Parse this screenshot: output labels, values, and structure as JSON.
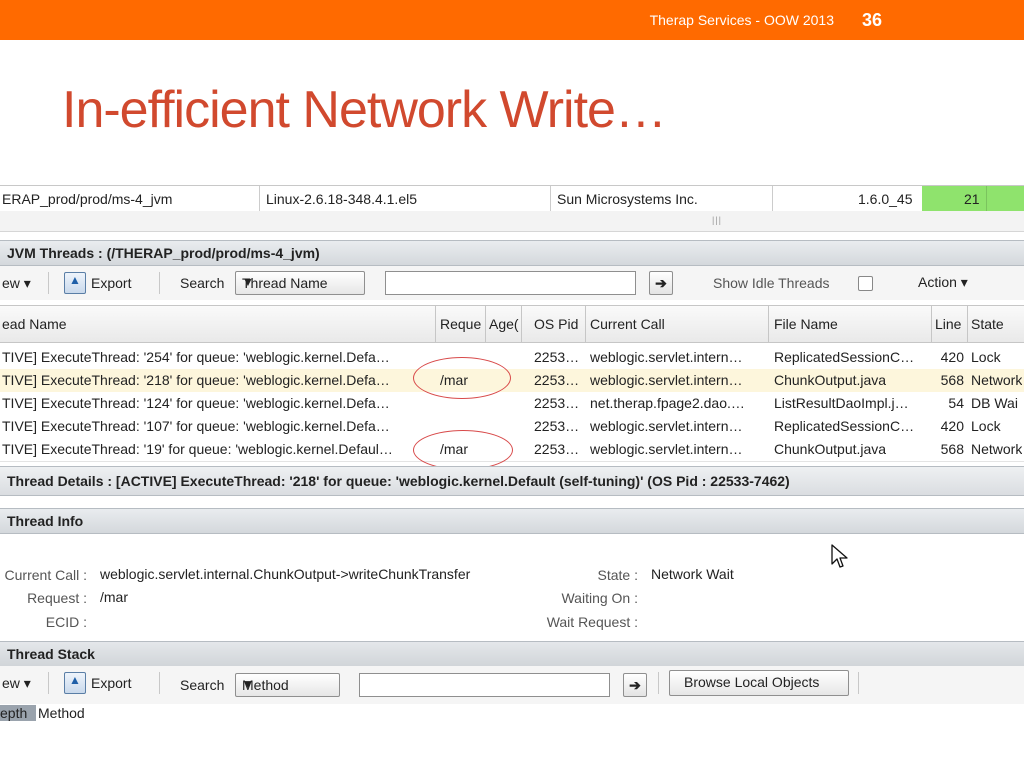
{
  "slide": {
    "brand": "Therap Services - OOW 2013",
    "page_number": "36",
    "title": "In-efficient Network Write…"
  },
  "summary_row": {
    "name": "ERAP_prod/prod/ms-4_jvm",
    "os": "Linux-2.6.18-348.4.1.el5",
    "vendor": "Sun Microsystems Inc.",
    "version": "1.6.0_45",
    "count": "21",
    "grip": "|||"
  },
  "jvm_threads": {
    "title": "JVM Threads : (/THERAP_prod/prod/ms-4_jvm)",
    "view_label": "ew ▾",
    "export_label": "Export",
    "search_label": "Search",
    "search_select": "Thread Name",
    "show_idle_label": "Show Idle Threads",
    "action_label": "Action ▾",
    "columns": [
      "ead Name",
      "Reque",
      "Age(",
      "OS Pid",
      "Current Call",
      "File Name",
      "Line",
      "State"
    ],
    "rows": [
      {
        "name": "TIVE] ExecuteThread: '254' for queue: 'weblogic.kernel.Defa…",
        "request": "",
        "pid": "2253…",
        "call": "weblogic.servlet.intern…",
        "file": "ReplicatedSessionC…",
        "line": "420",
        "state": "Lock"
      },
      {
        "name": "TIVE] ExecuteThread: '218' for queue: 'weblogic.kernel.Defa…",
        "request": "/mar",
        "pid": "2253…",
        "call": "weblogic.servlet.intern…",
        "file": "ChunkOutput.java",
        "line": "568",
        "state": "Network"
      },
      {
        "name": "TIVE] ExecuteThread: '124' for queue: 'weblogic.kernel.Defa…",
        "request": "",
        "pid": "2253…",
        "call": "net.therap.fpage2.dao.…",
        "file": "ListResultDaoImpl.j…",
        "line": "54",
        "state": "DB Wai"
      },
      {
        "name": "TIVE] ExecuteThread: '107' for queue: 'weblogic.kernel.Defa…",
        "request": "",
        "pid": "2253…",
        "call": "weblogic.servlet.intern…",
        "file": "ReplicatedSessionC…",
        "line": "420",
        "state": "Lock"
      },
      {
        "name": "TIVE] ExecuteThread: '19' for queue: 'weblogic.kernel.Defaul…",
        "request": "/mar",
        "pid": "2253…",
        "call": "weblogic.servlet.intern…",
        "file": "ChunkOutput.java",
        "line": "568",
        "state": "Network"
      }
    ]
  },
  "thread_details": {
    "title": "Thread Details : [ACTIVE] ExecuteThread: '218' for queue: 'weblogic.kernel.Default (self-tuning)' (OS Pid : 22533-7462)"
  },
  "thread_info": {
    "title": "Thread Info",
    "current_call_label": "Current Call :",
    "current_call_value": "weblogic.servlet.internal.ChunkOutput->writeChunkTransfer",
    "request_label": "Request :",
    "request_value": "/mar",
    "ecid_label": "ECID :",
    "state_label": "State :",
    "state_value": "Network Wait",
    "waiting_on_label": "Waiting On :",
    "wait_request_label": "Wait Request :"
  },
  "thread_stack": {
    "title": "Thread Stack",
    "view_label": "ew ▾",
    "export_label": "Export",
    "search_label": "Search",
    "search_select": "Method",
    "browse_label": "Browse Local Objects",
    "col_depth": "epth",
    "col_method": "Method"
  }
}
